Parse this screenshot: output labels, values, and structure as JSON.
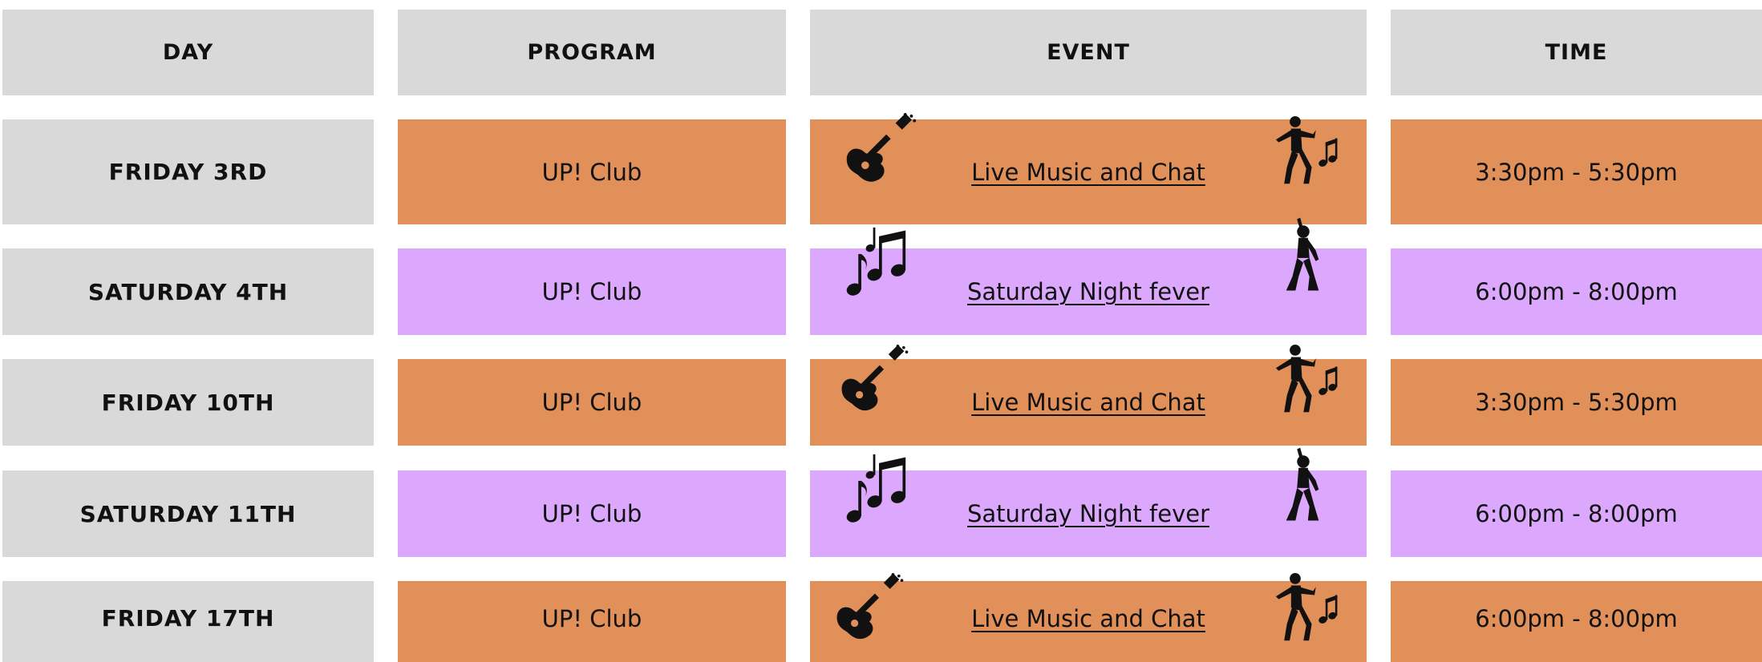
{
  "colors": {
    "header_bg": "#d9d9d9",
    "day_bg": "#d9d9d9",
    "friday_row": "#e1905a",
    "saturday_row": "#dba8fd",
    "text": "#111111"
  },
  "headers": {
    "day": "DAY",
    "program": "PROGRAM",
    "event": "EVENT",
    "time": "TIME"
  },
  "rows": [
    {
      "day": "FRIDAY 3RD",
      "program": "UP! Club",
      "event": "Live Music and Chat",
      "time": "3:30pm - 5:30pm",
      "left_icon": "guitar-icon",
      "right_icon": "dancer-music-icon"
    },
    {
      "day": "SATURDAY 4TH",
      "program": "UP! Club",
      "event": "Saturday Night fever",
      "time": "6:00pm - 8:00pm",
      "left_icon": "music-notes-icon",
      "right_icon": "disco-dancer-icon"
    },
    {
      "day": "FRIDAY 10TH",
      "program": "UP! Club",
      "event": "Live Music and Chat",
      "time": "3:30pm - 5:30pm",
      "left_icon": "guitar-icon",
      "right_icon": "dancer-music-icon"
    },
    {
      "day": "SATURDAY 11TH",
      "program": "UP! Club",
      "event": "Saturday Night fever",
      "time": "6:00pm - 8:00pm",
      "left_icon": "music-notes-icon",
      "right_icon": "disco-dancer-icon"
    },
    {
      "day": "FRIDAY 17TH",
      "program": "UP! Club",
      "event": "Live Music and Chat",
      "time": "6:00pm - 8:00pm",
      "left_icon": "guitar-icon",
      "right_icon": "dancer-music-icon"
    }
  ]
}
